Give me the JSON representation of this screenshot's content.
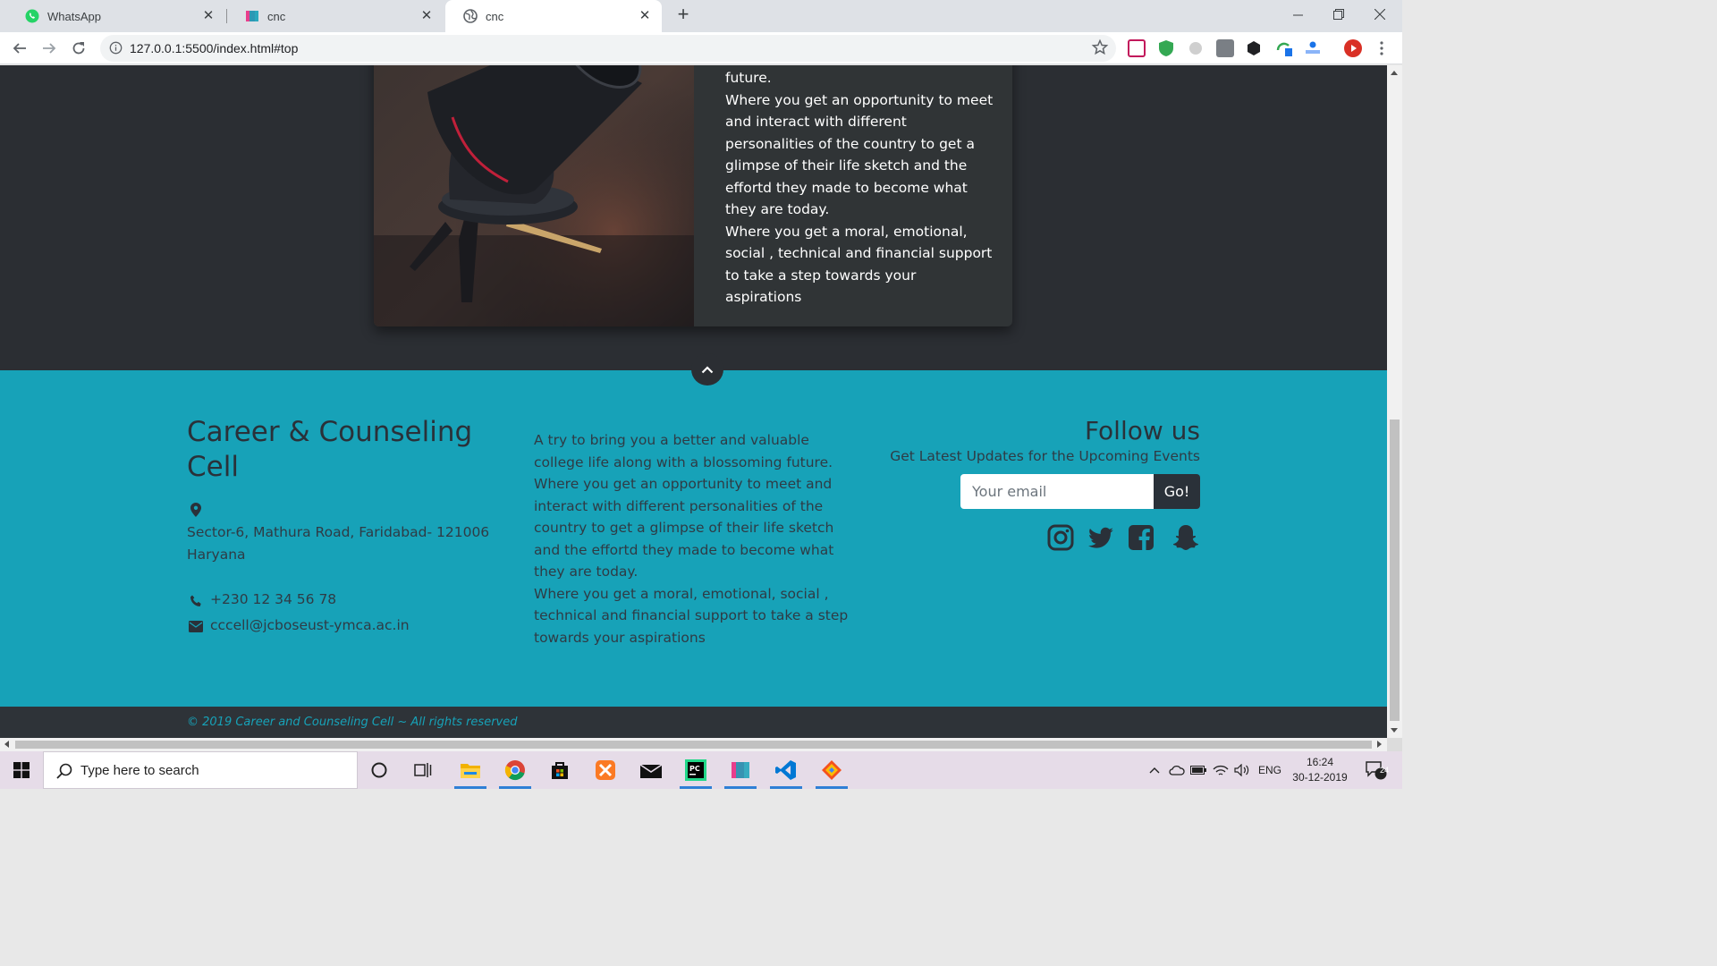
{
  "browser": {
    "tabs": [
      {
        "title": "WhatsApp",
        "active": false
      },
      {
        "title": "cnc",
        "active": false
      },
      {
        "title": "cnc",
        "active": true
      }
    ],
    "url": "127.0.0.1:5500/index.html#top"
  },
  "card": {
    "paragraphs": [
      "future.",
      "Where you get an opportunity to meet and interact with different personalities of the country to get a glimpse of their life sketch and the effortd they made to become what they are today.",
      "Where you get a moral, emotional, social , technical and financial support to take a step towards your aspirations"
    ]
  },
  "footer": {
    "title": "Career & Counseling Cell",
    "address_line1": "Sector-6, Mathura Road, Faridabad- 121006",
    "address_line2": "Haryana",
    "phone": "+230 12 34 56 78",
    "email": "cccell@jcboseust-ymca.ac.in",
    "about": [
      "A try to bring you a better and valuable college life along with a blossoming future.",
      "Where you get an opportunity to meet and interact with different personalities of the country to get a glimpse of their life sketch and the effortd they made to become what they are today.",
      "Where you get a moral, emotional, social , technical and financial support to take a step towards your aspirations"
    ],
    "follow_title": "Follow us",
    "follow_subtitle": "Get Latest Updates for the Upcoming Events",
    "email_placeholder": "Your email",
    "go_label": "Go!",
    "social": [
      "instagram-icon",
      "twitter-icon",
      "facebook-icon",
      "snapchat-icon"
    ],
    "copyright": "© 2019 Career and Counseling Cell ~ All rights reserved"
  },
  "taskbar": {
    "search_placeholder": "Type here to search",
    "language": "ENG",
    "time": "16:24",
    "date": "30-12-2019",
    "notification_count": "24"
  },
  "colors": {
    "footer_bg": "#17a2b8",
    "page_dark": "#2b2e33",
    "card_bg": "#303436",
    "copyright_bg": "#2e3338"
  }
}
